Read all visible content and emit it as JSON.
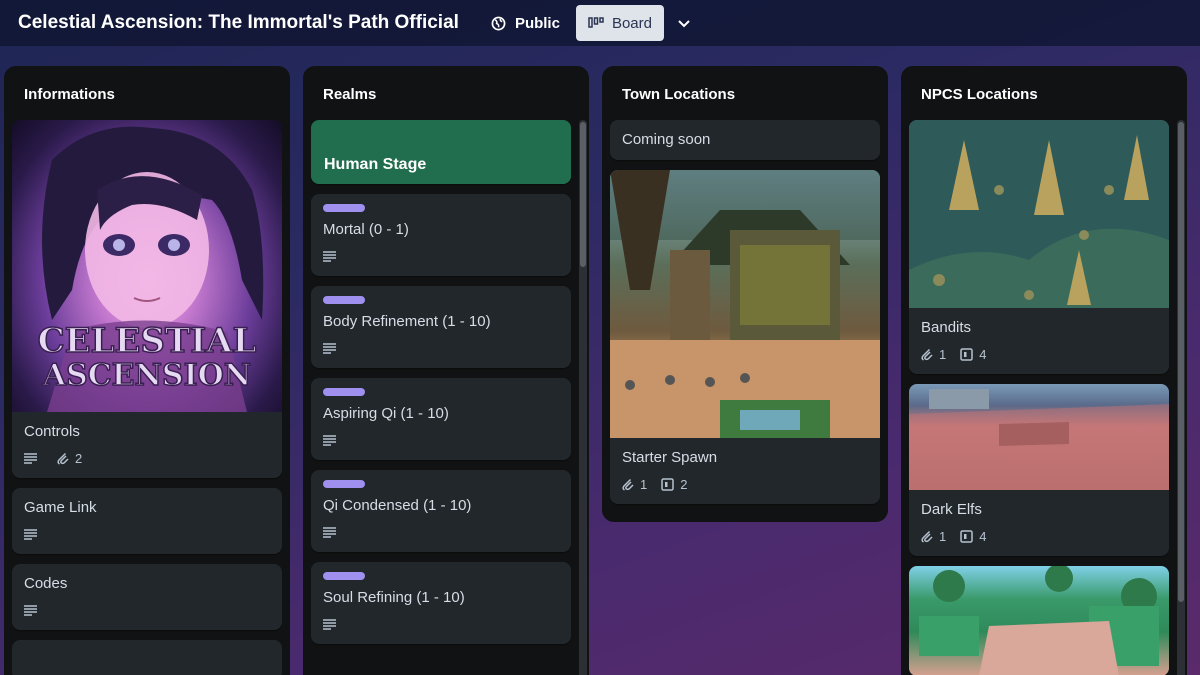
{
  "header": {
    "board_title": "Celestial Ascension: The Immortal's Path Official",
    "visibility_label": "Public",
    "view_label": "Board"
  },
  "lists": [
    {
      "title": "Informations",
      "cards": [
        {
          "title": "Controls",
          "attachments": "2"
        },
        {
          "title": "Game Link"
        },
        {
          "title": "Codes"
        }
      ],
      "cover_art_text": [
        "CELESTIAL",
        "ASCENSION"
      ]
    },
    {
      "title": "Realms",
      "cards": [
        {
          "title": "Human Stage"
        },
        {
          "title": "Mortal (0 - 1)"
        },
        {
          "title": "Body Refinement (1 - 10)"
        },
        {
          "title": "Aspiring Qi (1 - 10)"
        },
        {
          "title": "Qi Condensed (1 - 10)"
        },
        {
          "title": "Soul Refining (1 - 10)"
        }
      ]
    },
    {
      "title": "Town Locations",
      "cards": [
        {
          "title": "Coming soon"
        },
        {
          "title": "Starter Spawn",
          "attachments": "1",
          "checklist": "2"
        }
      ]
    },
    {
      "title": "NPCS Locations",
      "cards": [
        {
          "title": "Bandits",
          "attachments": "1",
          "checklist": "4"
        },
        {
          "title": "Dark Elfs",
          "attachments": "1",
          "checklist": "4"
        }
      ]
    }
  ],
  "colors": {
    "label_purple": "#9f8fef",
    "cover_green": "#216e4e",
    "list_bg": "#111213",
    "card_bg": "#22272b"
  },
  "icons": [
    "globe-icon",
    "board-icon",
    "chevron-down-icon",
    "description-icon",
    "attachment-icon",
    "checklist-icon"
  ]
}
